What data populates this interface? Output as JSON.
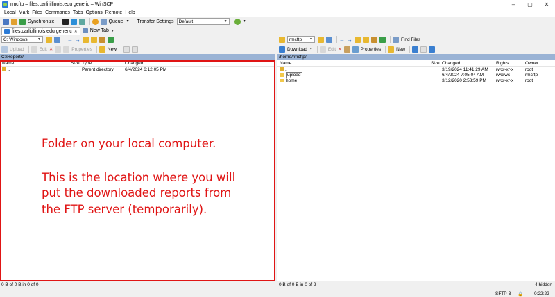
{
  "window": {
    "title": "rmcftp – files.carli.illinois.edu generic – WinSCP",
    "controls": [
      "–",
      "▢",
      "✕"
    ]
  },
  "menu": [
    "Local",
    "Mark",
    "Files",
    "Commands",
    "Tabs",
    "Options",
    "Remote",
    "Help"
  ],
  "toolbar": {
    "synchronize": "Synchronize",
    "queue": "Queue",
    "transfer_settings": "Transfer Settings",
    "transfer_preset": "Default"
  },
  "tabs": [
    {
      "label": "files.carli.illinois.edu generic",
      "active": true
    },
    {
      "label": "New Tab",
      "active": false
    }
  ],
  "local": {
    "drive": "C: Windows",
    "buttons": {
      "upload": "Upload",
      "edit": "Edit",
      "properties": "Properties",
      "new": "New"
    },
    "path": "C:\\Reports\\",
    "columns": {
      "name": "Name",
      "size": "Size",
      "type": "Type",
      "changed": "Changed"
    },
    "rows": [
      {
        "name": "..",
        "size": "",
        "type": "Parent directory",
        "changed": "6/4/2024 6:12:05 PM"
      }
    ],
    "status": "0 B of 0 B in 0 of 0"
  },
  "remote": {
    "location": "rmcftp",
    "find_files": "Find Files",
    "buttons": {
      "download": "Download",
      "edit": "Edit",
      "properties": "Properties",
      "new": "New"
    },
    "path": "/home/rmcftp/",
    "columns": {
      "name": "Name",
      "size": "Size",
      "changed": "Changed",
      "rights": "Rights",
      "owner": "Owner"
    },
    "rows": [
      {
        "name": "..",
        "size": "",
        "changed": "3/19/2024 11:41:29 AM",
        "rights": "rwxr-xr-x",
        "owner": "root"
      },
      {
        "name": "upload",
        "size": "",
        "changed": "6/4/2024 7:05:04 AM",
        "rights": "rwxrws---",
        "owner": "rmcftp"
      },
      {
        "name": "home",
        "size": "",
        "changed": "3/12/2020 2:53:59 PM",
        "rights": "rwxr-xr-x",
        "owner": "root"
      }
    ],
    "status": "0 B of 0 B in 0 of 2",
    "hidden_count": "4 hidden"
  },
  "bottom": {
    "protocol": "SFTP-3",
    "elapsed": "0:22:22"
  },
  "annotation": {
    "line1": "Folder on your local computer.",
    "line2": "This is the location where you will",
    "line3": "put the downloaded reports from",
    "line4": "the FTP server (temporarily)."
  },
  "colors": {
    "annotation": "#e01515",
    "path_bar": "#9ab3d5"
  }
}
